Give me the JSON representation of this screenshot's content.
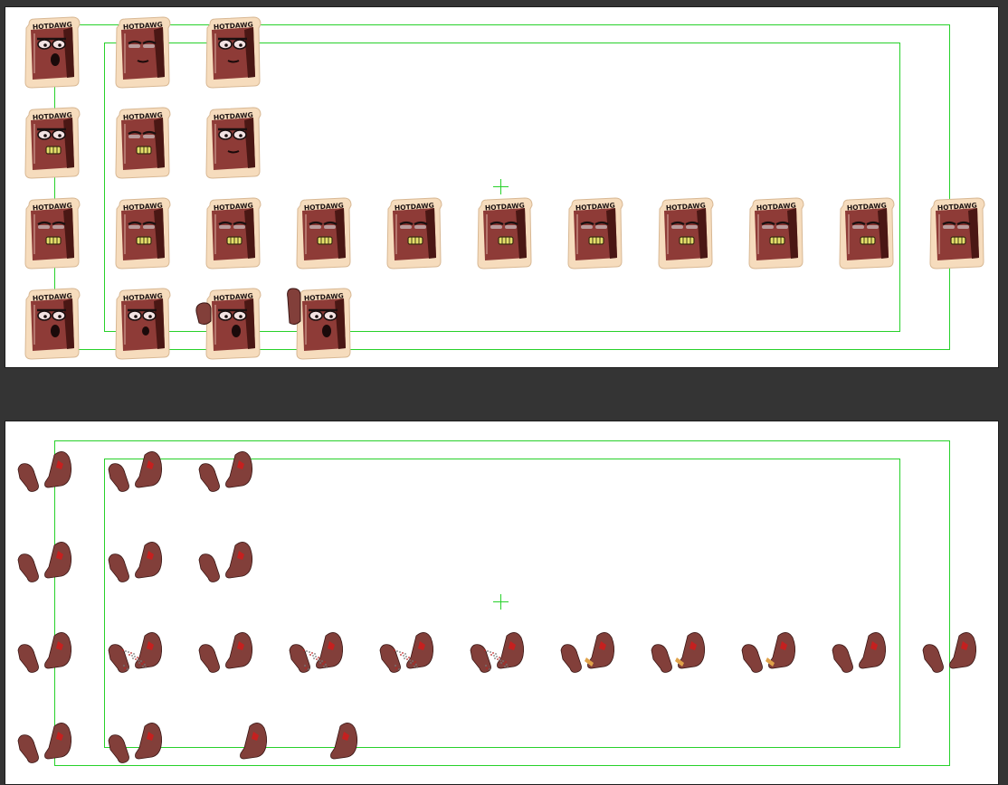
{
  "canvas_top": {
    "sprite_text": "HOTDAWG",
    "rows": [
      {
        "frames": [
          "talk-open",
          "eyes-closed",
          "mouth-closed"
        ]
      },
      {
        "frames": [
          "grin",
          "squint",
          "smirk"
        ]
      },
      {
        "frames": [
          "grin-brows",
          "blink-1",
          "blink-2",
          "blink-3",
          "blink-4",
          "blink-5",
          "blink-6",
          "blink-7",
          "blink-8",
          "blink-9",
          "blink-10"
        ]
      },
      {
        "frames": [
          "shock",
          "surprised",
          "fist-raise",
          "fist-up"
        ]
      }
    ]
  },
  "canvas_bottom": {
    "rows": [
      {
        "frames": [
          "arms-1",
          "arms-2",
          "arms-3"
        ]
      },
      {
        "frames": [
          "arms-4",
          "arms-5",
          "arms-6"
        ]
      },
      {
        "frames": [
          "arms-7",
          "arms-crumb-1",
          "arms-8",
          "arms-crumb-2",
          "arms-crumb-3",
          "arms-crumb-4",
          "arms-dog-1",
          "arms-dog-2",
          "arms-dog-3",
          "arms-9",
          "arms-10"
        ]
      },
      {
        "frames": [
          "arms-11",
          "arms-12",
          "arm-single-1",
          "arm-single-2"
        ]
      }
    ]
  },
  "colors": {
    "guide": "#27d12a",
    "sausage": "#8e3b37",
    "bun": "#f6dcbd",
    "arm": "#823f3a"
  }
}
